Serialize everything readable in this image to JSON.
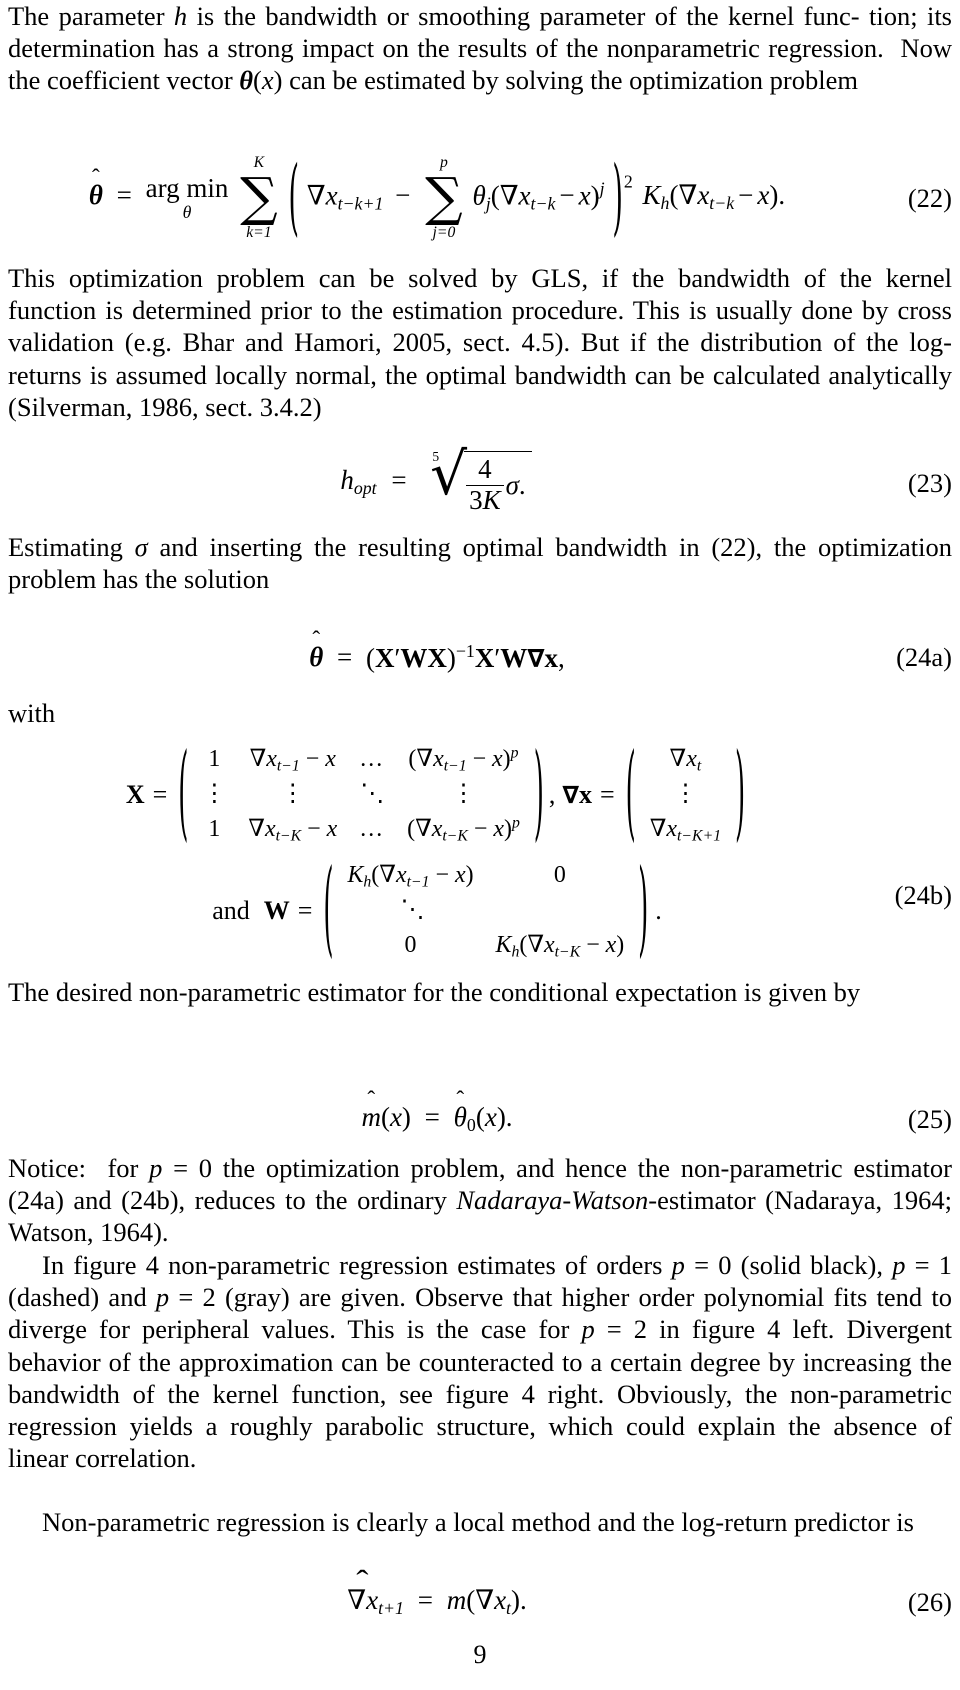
{
  "document": {
    "page_number": "9"
  },
  "paragraphs": {
    "p1_line1": "The parameter h is the bandwidth or smoothing parameter of the kernel func-",
    "p1_line2": "tion; its determination has a strong impact on the results of the nonparametric",
    "p1_line3": "regression.  Now the coefficient vector θ(x) can be estimated by solving the",
    "p1_line4": "optimization problem",
    "p2": "This optimization problem can be solved by GLS, if the bandwidth of the kernel function is determined prior to the estimation procedure. This is usually done by cross validation (e.g. Bhar and Hamori, 2005, sect. 4.5). But if the distribution of the log-returns is assumed locally normal, the optimal bandwidth can be calculated analytically (Silverman, 1986, sect. 3.4.2)",
    "p3": "Estimating σ and inserting the resulting optimal bandwidth in (22), the optimization problem has the solution",
    "with_label": "with",
    "and_label": "and",
    "p4": "The desired non-parametric estimator for the conditional expectation is given by",
    "p5": "Notice: for p = 0 the optimization problem, and hence the non-parametric estimator (24a) and (24b), reduces to the ordinary Nadaraya-Watson-estimator (Nadaraya, 1964; Watson, 1964).",
    "p6": "In figure 4 non-parametric regression estimates of orders p = 0 (solid black), p = 1 (dashed) and p = 2 (gray) are given. Observe that higher order polynomial fits tend to diverge for peripheral values. This is the case for p = 2 in figure 4 left. Divergent behavior of the approximation can be counteracted to a certain degree by increasing the bandwidth of the kernel function, see figure 4 right. Obviously, the non-parametric regression yields a roughly parabolic structure, which could explain the absence of linear correlation.",
    "p7": "Non-parametric regression is clearly a local method and the log-return predictor is"
  },
  "equations": {
    "eq22": {
      "tag": "(22)",
      "lhs": "θ̂",
      "eq": "=",
      "op": "arg min",
      "op_sub": "θ",
      "sum1_upper": "K",
      "sum1_lower": "k=1",
      "term1": "∇x",
      "term1_sub": "t−k+1",
      "minus": "−",
      "sum2_upper": "p",
      "sum2_lower": "j=0",
      "coef": "θ",
      "coef_sub": "j",
      "inner": "(∇x",
      "inner_sub": "t−k",
      "inner_rest": "− x)",
      "inner_sup": "j",
      "outer_sup": "2",
      "kernel": "K",
      "kernel_sub": "h",
      "kernel_arg": "(∇x",
      "kernel_arg_sub": "t−k",
      "kernel_arg_rest": "− x)."
    },
    "eq23": {
      "tag": "(23)",
      "lhs": "h",
      "lhs_sub": "opt",
      "eq": "=",
      "root_index": "5",
      "num": "4",
      "den": "3K",
      "sigma": "σ."
    },
    "eq24a": {
      "tag": "(24a)",
      "text": "θ̂ = (X′WX)−1X′W∇x,"
    },
    "eq24b": {
      "tag": "(24b)",
      "X_label": "X",
      "X_eq": "=",
      "X_rows": [
        [
          "1",
          "∇x",
          "t−1",
          "− x",
          "…",
          "(∇x",
          "t−1",
          "− x)",
          "p"
        ],
        [
          "⋮",
          "⋮",
          "",
          "",
          "⋱",
          "⋮",
          "",
          "",
          ""
        ],
        [
          "1",
          "∇x",
          "t−K",
          "− x",
          "…",
          "(∇x",
          "t−K",
          "− x)",
          "p"
        ]
      ],
      "comma": ",",
      "gradx_label": "∇x",
      "gradx_eq": "=",
      "gradx_rows": [
        "∇x_t",
        "⋮",
        "∇x_{t−K+1}"
      ],
      "W_label": "W",
      "W_eq": "=",
      "W_cells": {
        "top_left": "K_h(∇x_{t−1} − x)",
        "top_right": "0",
        "middle": "⋱",
        "bottom_left": "0",
        "bottom_right": "K_h(∇x_{t−K} − x)"
      },
      "period": "."
    },
    "eq25": {
      "tag": "(25)",
      "text": "m̂(x) = θ̂0(x)."
    },
    "eq26": {
      "tag": "(26)",
      "text": "∇x_{t+1} = m(∇x_t)."
    }
  },
  "symbols": {
    "nabla": "∇",
    "theta": "θ",
    "sigma": "σ",
    "sum": "∑",
    "ldots": "…",
    "vdots": "⋮",
    "ddots": "⋱",
    "hat": "ˆ"
  }
}
